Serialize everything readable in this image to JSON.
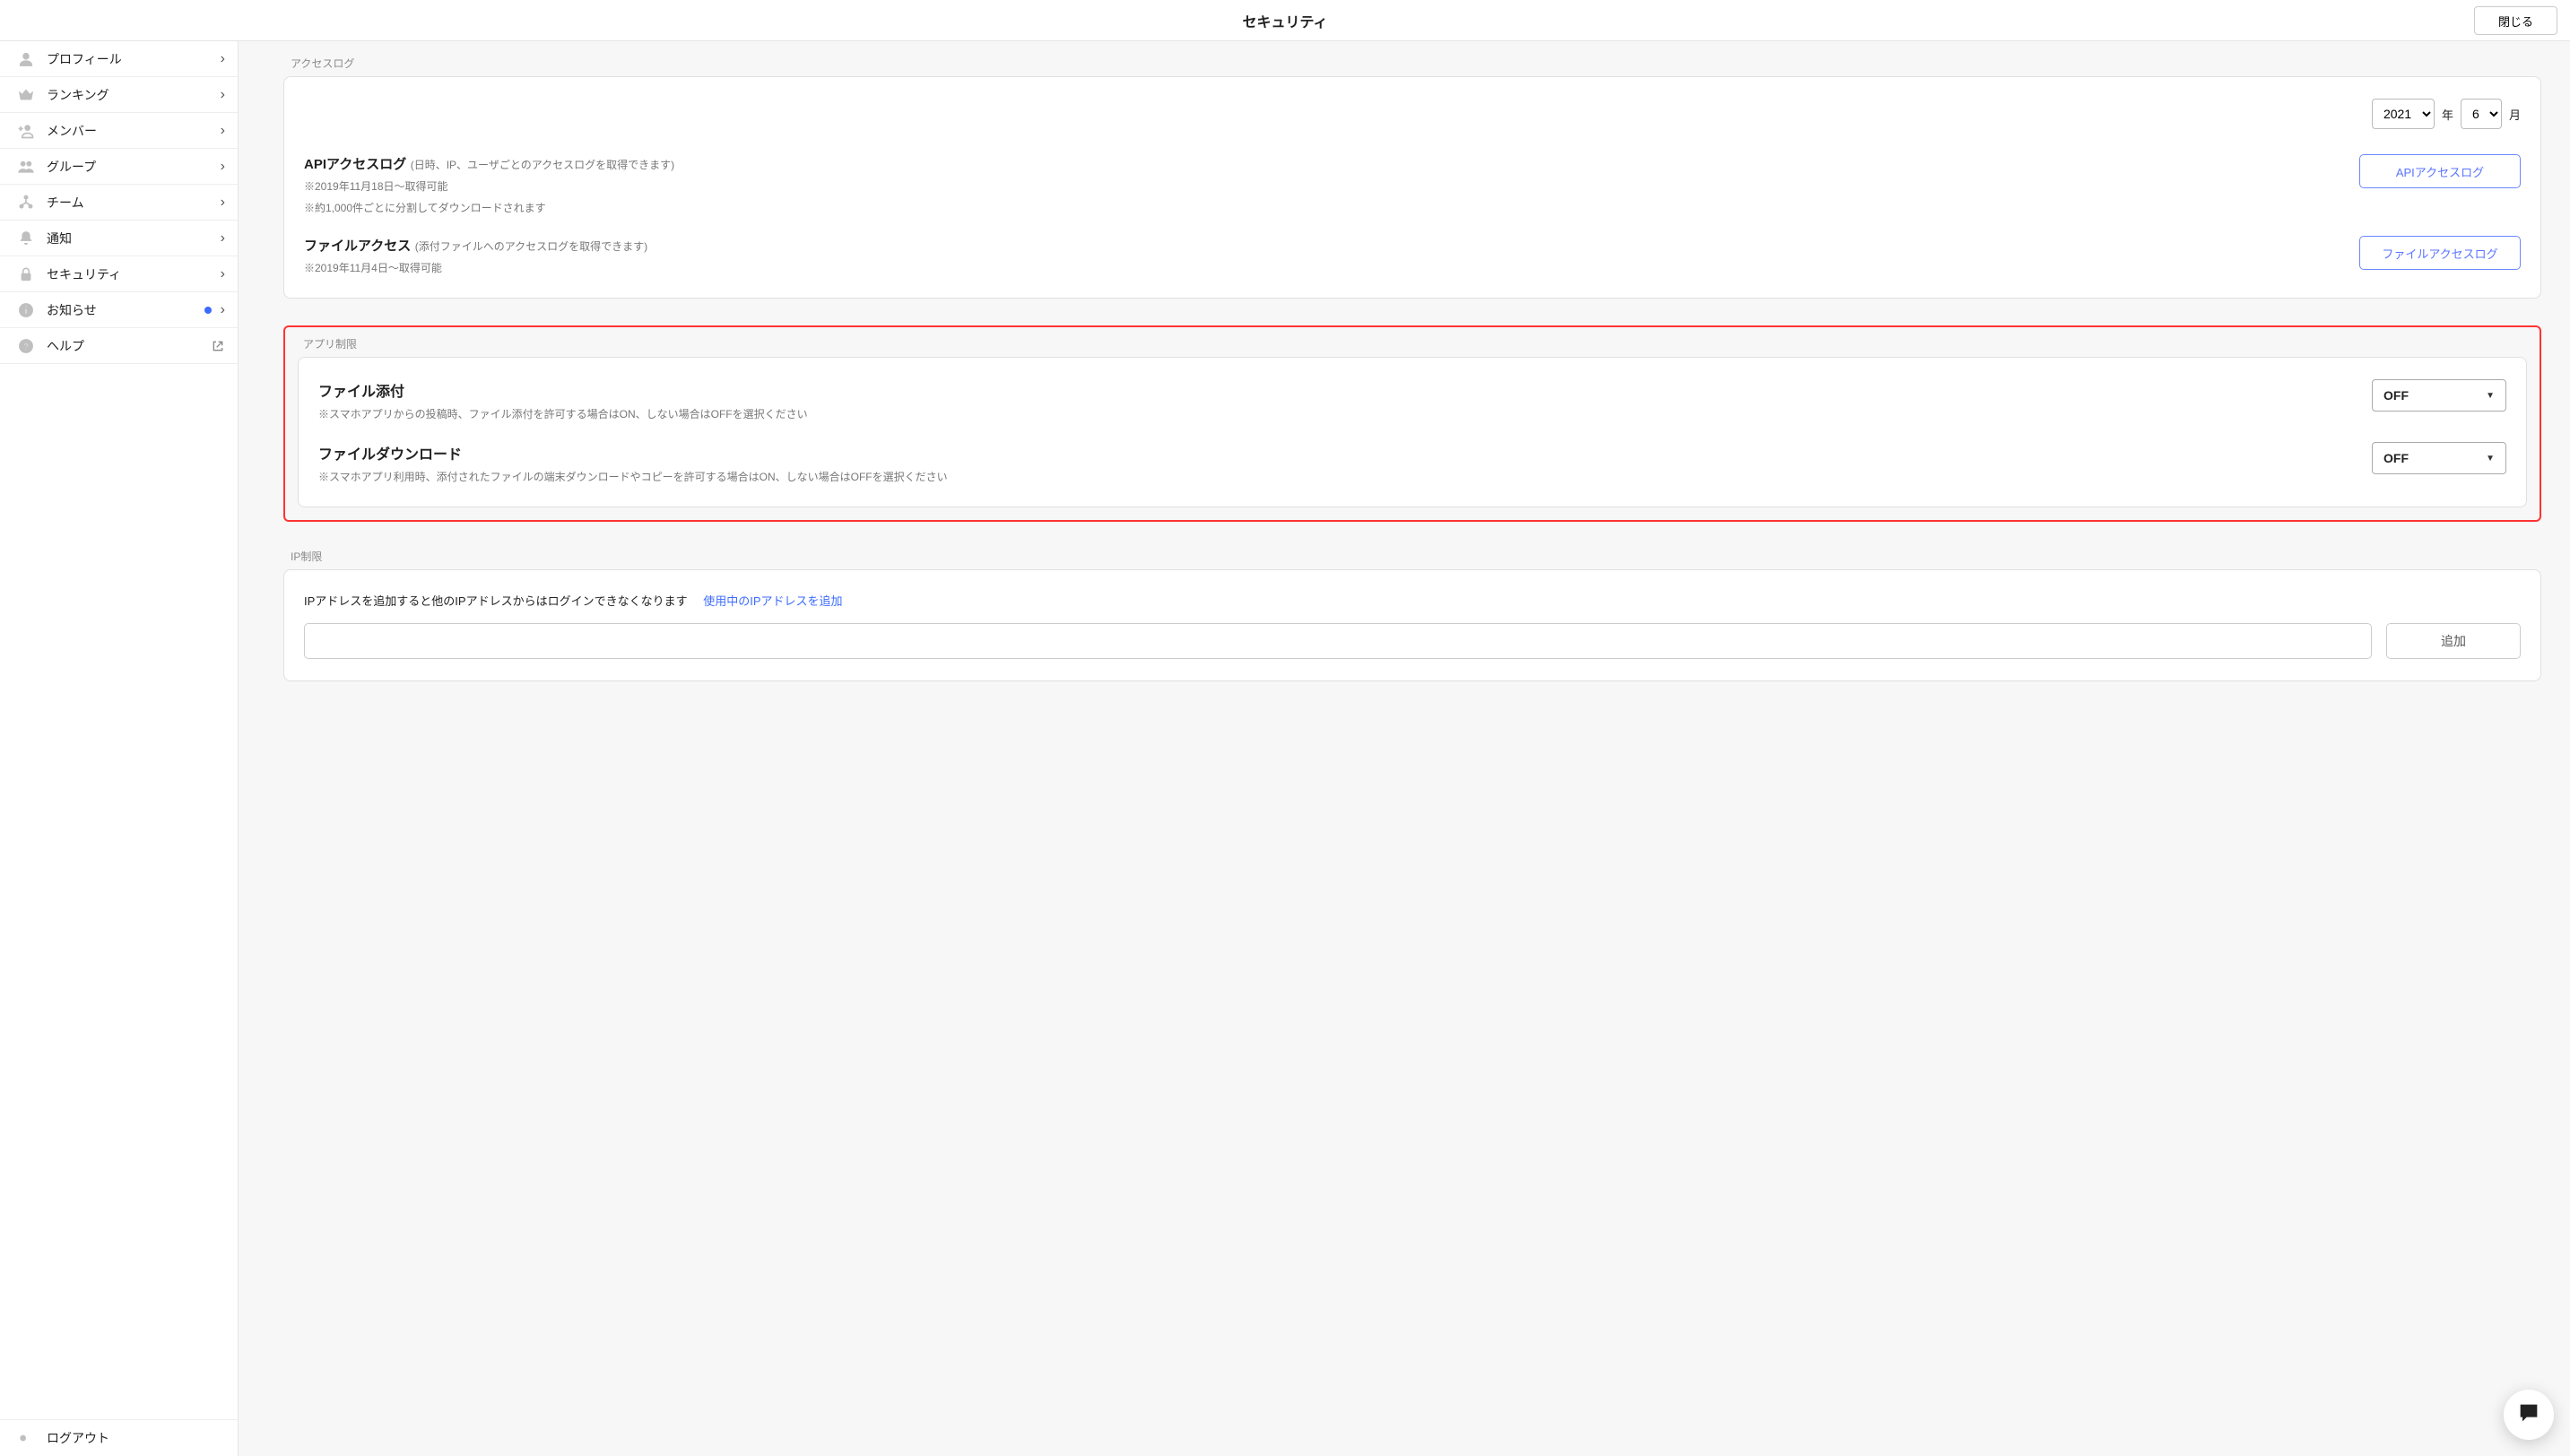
{
  "header": {
    "title": "セキュリティ",
    "close_label": "閉じる"
  },
  "sidebar": {
    "items": [
      {
        "id": "profile",
        "label": "プロフィール",
        "icon": "person-icon",
        "has_chevron": true
      },
      {
        "id": "ranking",
        "label": "ランキング",
        "icon": "crown-icon",
        "has_chevron": true
      },
      {
        "id": "member",
        "label": "メンバー",
        "icon": "add-person-icon",
        "has_chevron": true
      },
      {
        "id": "group",
        "label": "グループ",
        "icon": "people-icon",
        "has_chevron": true
      },
      {
        "id": "team",
        "label": "チーム",
        "icon": "org-icon",
        "has_chevron": true
      },
      {
        "id": "notify",
        "label": "通知",
        "icon": "bell-icon",
        "has_chevron": true
      },
      {
        "id": "security",
        "label": "セキュリティ",
        "icon": "lock-icon",
        "has_chevron": true
      },
      {
        "id": "news",
        "label": "お知らせ",
        "icon": "info-icon",
        "has_chevron": true,
        "has_dot": true
      },
      {
        "id": "help",
        "label": "ヘルプ",
        "icon": "question-icon",
        "external": true
      }
    ],
    "logout_label": "ログアウト"
  },
  "access_log": {
    "section_title": "アクセスログ",
    "year_value": "2021",
    "year_suffix": "年",
    "month_value": "6",
    "month_suffix": "月",
    "api": {
      "title": "APIアクセスログ",
      "title_desc": "(日時、IP、ユーザごとのアクセスログを取得できます)",
      "note1": "※2019年11月18日～取得可能",
      "note2": "※約1,000件ごとに分割してダウンロードされます",
      "button_label": "APIアクセスログ"
    },
    "file": {
      "title": "ファイルアクセス",
      "title_desc": "(添付ファイルへのアクセスログを取得できます)",
      "note1": "※2019年11月4日～取得可能",
      "button_label": "ファイルアクセスログ"
    }
  },
  "app_restriction": {
    "section_title": "アプリ制限",
    "attach": {
      "title": "ファイル添付",
      "note": "※スマホアプリからの投稿時、ファイル添付を許可する場合はON、しない場合はOFFを選択ください",
      "value": "OFF"
    },
    "download": {
      "title": "ファイルダウンロード",
      "note": "※スマホアプリ利用時、添付されたファイルの端末ダウンロードやコピーを許可する場合はON、しない場合はOFFを選択ください",
      "value": "OFF"
    }
  },
  "ip": {
    "section_title": "IP制限",
    "desc": "IPアドレスを追加すると他のIPアドレスからはログインできなくなります",
    "link": "使用中のIPアドレスを追加",
    "add_button": "追加",
    "input_value": ""
  }
}
